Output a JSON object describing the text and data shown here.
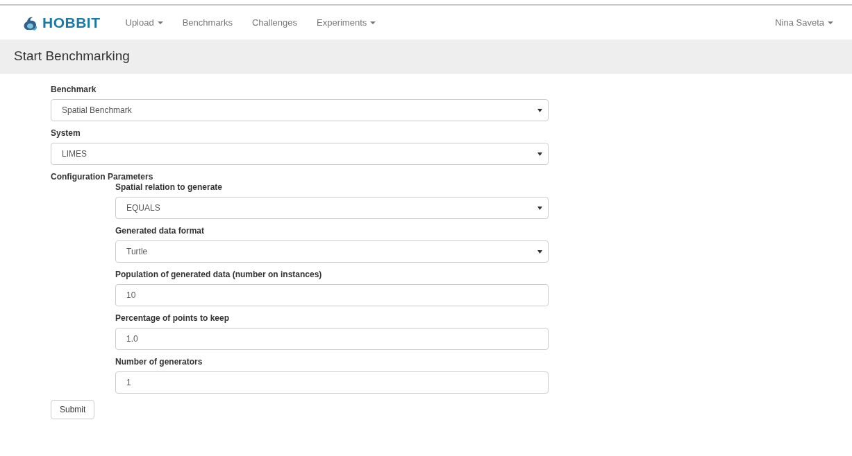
{
  "navbar": {
    "brand": "HOBBIT",
    "items": [
      {
        "label": "Upload",
        "dropdown": true
      },
      {
        "label": "Benchmarks",
        "dropdown": false
      },
      {
        "label": "Challenges",
        "dropdown": false
      },
      {
        "label": "Experiments",
        "dropdown": true
      }
    ],
    "user": {
      "label": "Nina Saveta",
      "dropdown": true
    }
  },
  "page_header": {
    "title": "Start Benchmarking"
  },
  "form": {
    "fields": [
      {
        "label": "Benchmark",
        "kind": "select",
        "value": "Spatial Benchmark"
      },
      {
        "label": "System",
        "kind": "select",
        "value": "LIMES"
      }
    ],
    "parameters": {
      "title": "Configuration Parameters",
      "fields": [
        {
          "label": "Spatial relation to generate",
          "kind": "select",
          "value": "EQUALS"
        },
        {
          "label": "Generated data format",
          "kind": "select",
          "value": "Turtle"
        },
        {
          "label": "Population of generated data (number on instances)",
          "kind": "text",
          "value": "10"
        },
        {
          "label": "Percentage of points to keep",
          "kind": "text",
          "value": "1.0"
        },
        {
          "label": "Number of generators",
          "kind": "text",
          "value": "1"
        }
      ]
    },
    "submit": "Submit"
  }
}
